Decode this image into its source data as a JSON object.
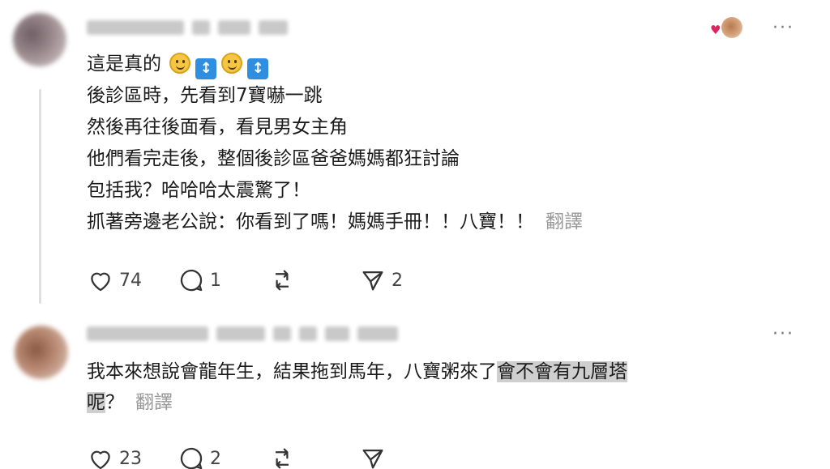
{
  "posts": [
    {
      "lines": [
        "這是真的",
        "後診區時，先看到7寶嚇一跳",
        "然後再往後面看，看見男女主角",
        "他們看完走後，整個後診區爸爸媽媽都狂討論",
        "包括我？哈哈哈太震驚了！",
        "抓著旁邊老公說：你看到了嗎！媽媽手冊！！八寶！！"
      ],
      "line1_emojis": [
        "smile-emoji",
        "up-down-arrow-emoji",
        "smile-emoji",
        "up-down-arrow-emoji"
      ],
      "translate_label": "翻譯",
      "more_label": "···",
      "reaction_icon": "heart-icon",
      "actions": {
        "like": "74",
        "reply": "1",
        "repost": "",
        "share": "2"
      }
    },
    {
      "text_before": "我本來想說會龍年生，結果拖到馬年，八寶粥來了",
      "text_highlight_1": "會不會有九層塔",
      "text_highlight_2": "呢",
      "text_after": "？",
      "translate_label": "翻譯",
      "more_label": "···",
      "actions": {
        "like": "23",
        "reply": "2",
        "repost": "",
        "share": ""
      }
    }
  ],
  "icons": {
    "like": "heart-outline-icon",
    "reply": "comment-bubble-icon",
    "repost": "repost-arrows-icon",
    "share": "send-paper-plane-icon"
  },
  "colors": {
    "text": "#1b1b1b",
    "muted": "#999999",
    "highlight": "#cfcfcf",
    "reaction_heart": "#e0245e"
  }
}
